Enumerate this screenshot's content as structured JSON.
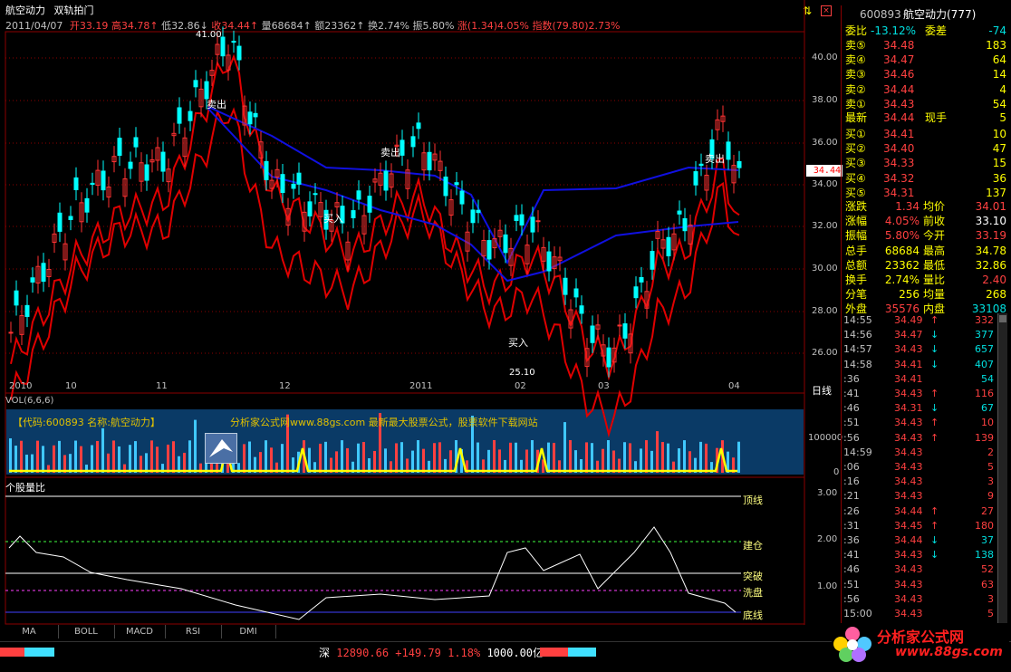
{
  "header": {
    "title": "航空动力",
    "indicator": "双轨拍门",
    "date": "2011/04/07",
    "open_label": "开",
    "open": "33.19",
    "high_label": "高",
    "high": "34.78",
    "low_label": "低",
    "low": "32.86",
    "close_label": "收",
    "close": "34.44",
    "vol_label": "量",
    "vol": "68684",
    "amt_label": "额",
    "amt": "23362",
    "turn_label": "换",
    "turn": "2.74%",
    "swing_label": "振",
    "swing": "5.80%",
    "chg_label": "涨",
    "chg": "(1.34)4.05%",
    "idx_label": "指数",
    "idx": "(79.80)2.73%"
  },
  "price_chart": {
    "y_ticks": [
      "40.00",
      "38.00",
      "36.00",
      "34.00",
      "32.00",
      "30.00",
      "28.00",
      "26.00"
    ],
    "current_price": "34.44",
    "high_label": "41.00",
    "low_label": "25.10",
    "annotations": {
      "sell1": "卖出",
      "buy1": "买入",
      "sell2": "卖出",
      "buy2": "买入",
      "sell3": "卖出"
    },
    "x_labels": [
      "2010",
      "10",
      "11",
      "12",
      "2011",
      "02",
      "03",
      "04"
    ],
    "period": "日线"
  },
  "vol_panel": {
    "title": "VOL(6,6,6)",
    "banner_left": "【代码:600893 名称:航空动力】",
    "banner_right": "分析家公式网www.88gs.com 最新最大股票公式，股票软件下载网站",
    "y_ticks": [
      "100000",
      "0"
    ]
  },
  "ratio_panel": {
    "title": "个股量比",
    "levels": [
      "顶线",
      "建仓",
      "突破",
      "洗盘",
      "底线"
    ],
    "y_ticks": [
      "3.00",
      "2.00",
      "1.00"
    ]
  },
  "tabs": [
    "MA",
    "BOLL",
    "MACD",
    "RSI",
    "DMI"
  ],
  "quote": {
    "code": "600893",
    "name": "航空动力(777)",
    "wb_label": "委比",
    "wb": "-13.12%",
    "wc_label": "委差",
    "wc": "-74",
    "asks": [
      {
        "l": "卖⑤",
        "p": "34.48",
        "v": "183"
      },
      {
        "l": "卖④",
        "p": "34.47",
        "v": "64"
      },
      {
        "l": "卖③",
        "p": "34.46",
        "v": "14"
      },
      {
        "l": "卖②",
        "p": "34.44",
        "v": "4"
      },
      {
        "l": "卖①",
        "p": "34.43",
        "v": "54"
      }
    ],
    "last_label": "最新",
    "last": "34.44",
    "cur_label": "现手",
    "cur": "5",
    "bids": [
      {
        "l": "买①",
        "p": "34.41",
        "v": "10"
      },
      {
        "l": "买②",
        "p": "34.40",
        "v": "47"
      },
      {
        "l": "买③",
        "p": "34.33",
        "v": "15"
      },
      {
        "l": "买④",
        "p": "34.32",
        "v": "36"
      },
      {
        "l": "买⑤",
        "p": "34.31",
        "v": "137"
      }
    ],
    "stats": [
      {
        "a": "涨跌",
        "av": "1.34",
        "b": "均价",
        "bv": "34.01"
      },
      {
        "a": "涨幅",
        "av": "4.05%",
        "b": "前收",
        "bv": "33.10"
      },
      {
        "a": "振幅",
        "av": "5.80%",
        "b": "今开",
        "bv": "33.19"
      },
      {
        "a": "总手",
        "av": "68684",
        "b": "最高",
        "bv": "34.78"
      },
      {
        "a": "总额",
        "av": "23362",
        "b": "最低",
        "bv": "32.86"
      },
      {
        "a": "换手",
        "av": "2.74%",
        "b": "量比",
        "bv": "2.40"
      },
      {
        "a": "分笔",
        "av": "256",
        "b": "均量",
        "bv": "268"
      },
      {
        "a": "外盘",
        "av": "35576",
        "b": "内盘",
        "bv": "33108"
      }
    ],
    "ticks": [
      {
        "t": "14:55",
        "p": "34.49",
        "d": "↑",
        "v": "332",
        "c": "r"
      },
      {
        "t": "14:56",
        "p": "34.47",
        "d": "↓",
        "v": "377",
        "c": "g"
      },
      {
        "t": "14:57",
        "p": "34.43",
        "d": "↓",
        "v": "657",
        "c": "g"
      },
      {
        "t": "14:58",
        "p": "34.41",
        "d": "↓",
        "v": "407",
        "c": "g"
      },
      {
        "t": ":36",
        "p": "34.41",
        "d": "",
        "v": "54",
        "c": "g"
      },
      {
        "t": ":41",
        "p": "34.43",
        "d": "↑",
        "v": "116",
        "c": "r"
      },
      {
        "t": ":46",
        "p": "34.31",
        "d": "↓",
        "v": "67",
        "c": "g"
      },
      {
        "t": ":51",
        "p": "34.43",
        "d": "↑",
        "v": "10",
        "c": "r"
      },
      {
        "t": ":56",
        "p": "34.43",
        "d": "↑",
        "v": "139",
        "c": "r"
      },
      {
        "t": "14:59",
        "p": "34.43",
        "d": "",
        "v": "2",
        "c": "r"
      },
      {
        "t": ":06",
        "p": "34.43",
        "d": "",
        "v": "5",
        "c": "r"
      },
      {
        "t": ":16",
        "p": "34.43",
        "d": "",
        "v": "3",
        "c": "r"
      },
      {
        "t": ":21",
        "p": "34.43",
        "d": "",
        "v": "9",
        "c": "r"
      },
      {
        "t": ":26",
        "p": "34.44",
        "d": "↑",
        "v": "27",
        "c": "r"
      },
      {
        "t": ":31",
        "p": "34.45",
        "d": "↑",
        "v": "180",
        "c": "r"
      },
      {
        "t": ":36",
        "p": "34.44",
        "d": "↓",
        "v": "37",
        "c": "g"
      },
      {
        "t": ":41",
        "p": "34.43",
        "d": "↓",
        "v": "138",
        "c": "g"
      },
      {
        "t": ":46",
        "p": "34.43",
        "d": "",
        "v": "52",
        "c": "r"
      },
      {
        "t": ":51",
        "p": "34.43",
        "d": "",
        "v": "63",
        "c": "r"
      },
      {
        "t": ":56",
        "p": "34.43",
        "d": "",
        "v": "3",
        "c": "r"
      },
      {
        "t": "15:00",
        "p": "34.43",
        "d": "",
        "v": "5",
        "c": "r"
      }
    ]
  },
  "status": {
    "market": "深",
    "index": "12890.66",
    "change": "+149.79",
    "pct": "1.18%",
    "amount": "1000.00亿"
  },
  "logo": {
    "text": "分析家公式网",
    "url": "www.88gs.com"
  },
  "colors": {
    "up": "#ff3232",
    "down": "#00ffff",
    "grid": "#8b0000",
    "band_red": "#e00000",
    "band_blue": "#1010e0",
    "yellow": "#ffff00"
  }
}
